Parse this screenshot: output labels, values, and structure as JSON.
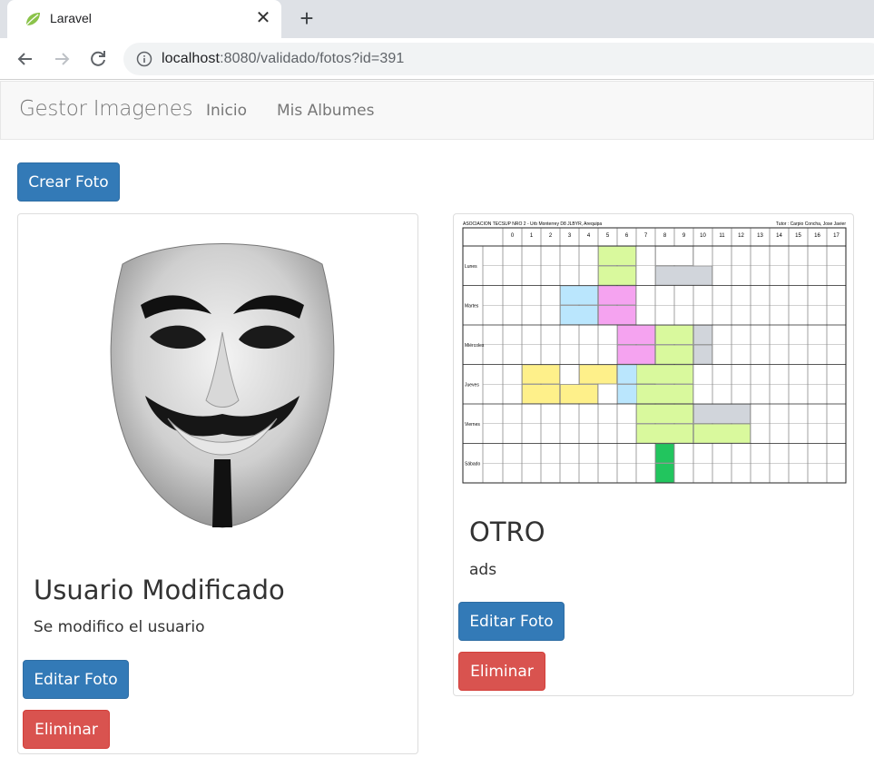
{
  "browser": {
    "tab_title": "Laravel",
    "tab_close": "✕",
    "new_tab": "+",
    "url_host": "localhost",
    "url_rest": ":8080/validado/fotos?id=391"
  },
  "navbar": {
    "brand": "Gestor Imagenes",
    "links": [
      "Inicio",
      "Mis Albumes"
    ]
  },
  "actions": {
    "create_label": "Crear Foto"
  },
  "cards": [
    {
      "title": "Usuario Modificado",
      "description": "Se modifico el usuario",
      "edit_label": "Editar Foto",
      "delete_label": "Eliminar",
      "image": "guy-fawkes-mask"
    },
    {
      "title": "OTRO",
      "description": "ads",
      "edit_label": "Editar Foto",
      "delete_label": "Eliminar",
      "image": "class-schedule-table",
      "schedule_header_left": "ASOCIACION TECSUP NRO 2 - Urb Monterrey D8 JLBYR, Arequipa",
      "schedule_header_right": "Tutor : Carpio Concha, Jose Javier",
      "schedule_periods": [
        "0",
        "1",
        "2",
        "3",
        "4",
        "5",
        "6",
        "7",
        "8",
        "9",
        "10",
        "11",
        "12",
        "13",
        "14",
        "15",
        "16",
        "17"
      ],
      "schedule_days": [
        "Lunes",
        "Martes",
        "Miércoles",
        "Jueves",
        "Viernes",
        "Sábado"
      ]
    }
  ],
  "colors": {
    "primary": "#337ab7",
    "danger": "#d9534f",
    "navbar_bg": "#f8f8f8"
  }
}
